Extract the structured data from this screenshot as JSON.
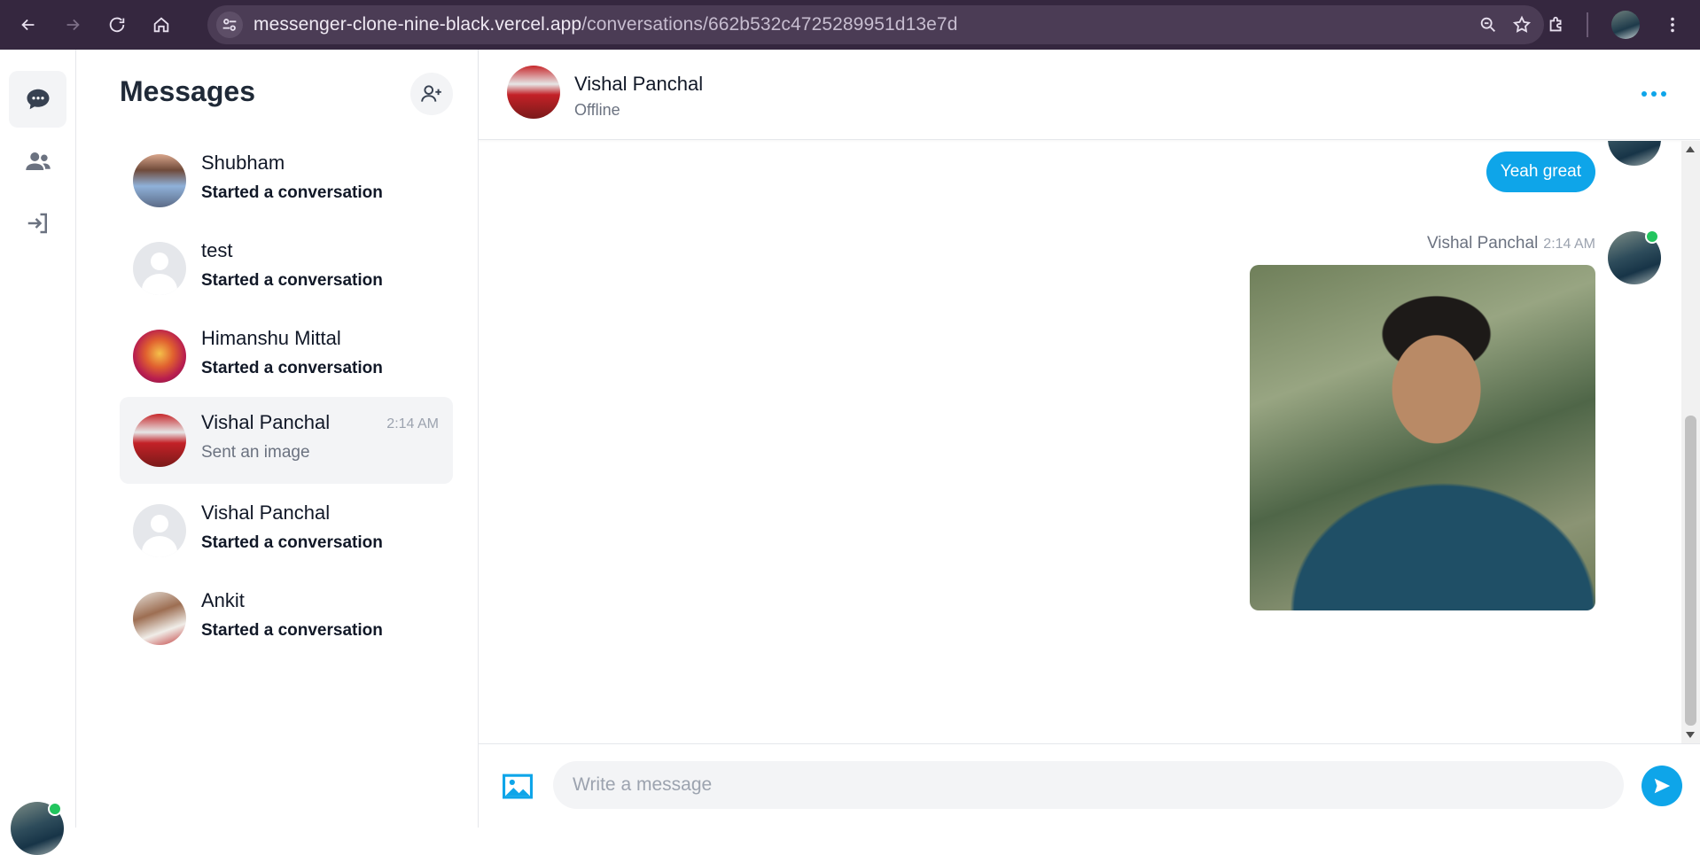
{
  "browser": {
    "url_host": "messenger-clone-nine-black.vercel.app",
    "url_path": "/conversations/662b532c4725289951d13e7d"
  },
  "sidebar": {
    "title": "Messages",
    "conversations": [
      {
        "name": "Shubham",
        "subtitle": "Started a conversation",
        "time": ""
      },
      {
        "name": "test",
        "subtitle": "Started a conversation",
        "time": ""
      },
      {
        "name": "Himanshu Mittal",
        "subtitle": "Started a conversation",
        "time": ""
      },
      {
        "name": "Vishal Panchal",
        "subtitle": "Sent an image",
        "time": "2:14 AM"
      },
      {
        "name": "Vishal Panchal",
        "subtitle": "Started a conversation",
        "time": ""
      },
      {
        "name": "Ankit",
        "subtitle": "Started a conversation",
        "time": ""
      }
    ]
  },
  "chat": {
    "contact_name": "Vishal Panchal",
    "contact_status": "Offline",
    "messages": [
      {
        "type": "text",
        "text": "Yeah great"
      },
      {
        "type": "image",
        "sender": "Vishal Panchal",
        "time": "2:14 AM"
      }
    ],
    "composer": {
      "placeholder": "Write a message"
    }
  },
  "colors": {
    "accent": "#0ea5e9",
    "online": "#22c55e",
    "chrome_bg": "#35273f"
  }
}
